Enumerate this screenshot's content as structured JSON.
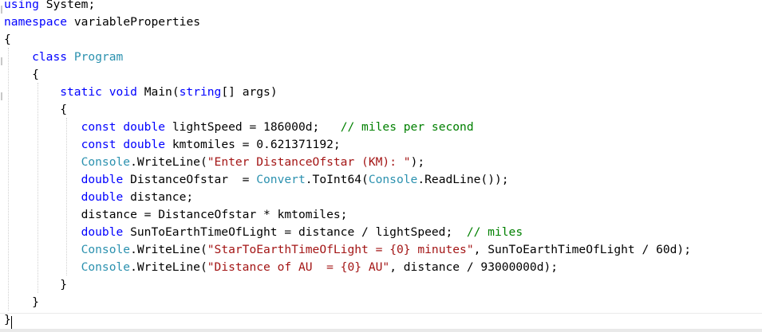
{
  "colors": {
    "keyword": "#0000ff",
    "type": "#2b91af",
    "string": "#a31515",
    "comment": "#008000",
    "plain": "#000000"
  },
  "lines": [
    {
      "indent": 0,
      "tokens": [
        {
          "t": "using",
          "c": "keyword"
        },
        {
          "t": " System;",
          "c": "plain"
        }
      ]
    },
    {
      "indent": 0,
      "tokens": [
        {
          "t": "namespace",
          "c": "keyword"
        },
        {
          "t": " variableProperties",
          "c": "plain"
        }
      ]
    },
    {
      "indent": 0,
      "tokens": [
        {
          "t": "{",
          "c": "plain"
        }
      ]
    },
    {
      "indent": 4,
      "tokens": [
        {
          "t": "class",
          "c": "keyword"
        },
        {
          "t": " ",
          "c": "plain"
        },
        {
          "t": "Program",
          "c": "type"
        }
      ]
    },
    {
      "indent": 4,
      "tokens": [
        {
          "t": "{",
          "c": "plain"
        }
      ]
    },
    {
      "indent": 8,
      "tokens": [
        {
          "t": "static",
          "c": "keyword"
        },
        {
          "t": " ",
          "c": "plain"
        },
        {
          "t": "void",
          "c": "keyword"
        },
        {
          "t": " Main(",
          "c": "plain"
        },
        {
          "t": "string",
          "c": "keyword"
        },
        {
          "t": "[] args)",
          "c": "plain"
        }
      ]
    },
    {
      "indent": 8,
      "tokens": [
        {
          "t": "{",
          "c": "plain"
        }
      ]
    },
    {
      "indent": 11,
      "tokens": [
        {
          "t": "const",
          "c": "keyword"
        },
        {
          "t": " ",
          "c": "plain"
        },
        {
          "t": "double",
          "c": "keyword"
        },
        {
          "t": " lightSpeed = 186000d;   ",
          "c": "plain"
        },
        {
          "t": "// miles per second",
          "c": "comment"
        }
      ]
    },
    {
      "indent": 11,
      "tokens": [
        {
          "t": "const",
          "c": "keyword"
        },
        {
          "t": " ",
          "c": "plain"
        },
        {
          "t": "double",
          "c": "keyword"
        },
        {
          "t": " kmtomiles = 0.621371192;",
          "c": "plain"
        }
      ]
    },
    {
      "indent": 11,
      "tokens": [
        {
          "t": "Console",
          "c": "type"
        },
        {
          "t": ".WriteLine(",
          "c": "plain"
        },
        {
          "t": "\"Enter DistanceOfstar (KM): \"",
          "c": "string"
        },
        {
          "t": ");",
          "c": "plain"
        }
      ]
    },
    {
      "indent": 11,
      "tokens": [
        {
          "t": "double",
          "c": "keyword"
        },
        {
          "t": " DistanceOfstar  = ",
          "c": "plain"
        },
        {
          "t": "Convert",
          "c": "type"
        },
        {
          "t": ".ToInt64(",
          "c": "plain"
        },
        {
          "t": "Console",
          "c": "type"
        },
        {
          "t": ".ReadLine());",
          "c": "plain"
        }
      ]
    },
    {
      "indent": 11,
      "tokens": [
        {
          "t": "double",
          "c": "keyword"
        },
        {
          "t": " distance;",
          "c": "plain"
        }
      ]
    },
    {
      "indent": 11,
      "tokens": [
        {
          "t": "distance = DistanceOfstar * kmtomiles;",
          "c": "plain"
        }
      ]
    },
    {
      "indent": 11,
      "tokens": [
        {
          "t": "double",
          "c": "keyword"
        },
        {
          "t": " SunToEarthTimeOfLight = distance / lightSpeed;  ",
          "c": "plain"
        },
        {
          "t": "// miles",
          "c": "comment"
        }
      ]
    },
    {
      "indent": 11,
      "tokens": [
        {
          "t": "Console",
          "c": "type"
        },
        {
          "t": ".WriteLine(",
          "c": "plain"
        },
        {
          "t": "\"StarToEarthTimeOfLight = {0} minutes\"",
          "c": "string"
        },
        {
          "t": ", SunToEarthTimeOfLight / 60d);",
          "c": "plain"
        }
      ]
    },
    {
      "indent": 11,
      "tokens": [
        {
          "t": "Console",
          "c": "type"
        },
        {
          "t": ".WriteLine(",
          "c": "plain"
        },
        {
          "t": "\"Distance of AU  = {0} AU\"",
          "c": "string"
        },
        {
          "t": ", distance / 93000000d);",
          "c": "plain"
        }
      ]
    },
    {
      "indent": 8,
      "tokens": [
        {
          "t": "}",
          "c": "plain"
        }
      ]
    },
    {
      "indent": 4,
      "tokens": [
        {
          "t": "}",
          "c": "plain"
        }
      ]
    },
    {
      "indent": 0,
      "tokens": [
        {
          "t": "}",
          "c": "plain"
        }
      ]
    }
  ]
}
